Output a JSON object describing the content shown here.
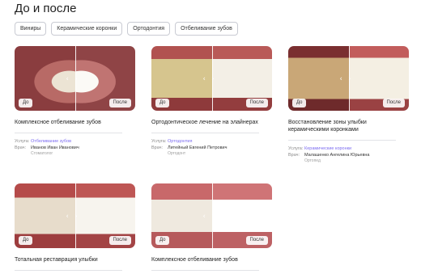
{
  "page": {
    "title": "До и после"
  },
  "filters": [
    "Виниры",
    "Керамические коронки",
    "Ортодонтия",
    "Отбеливание зубов"
  ],
  "labels": {
    "before": "До",
    "after": "После",
    "service": "Услуга:",
    "doctor": "Врач:"
  },
  "cards": [
    {
      "title": "Комплексное отбеливание зубов",
      "service": "Отбеливание зубов",
      "doctor": "Иванов Иван Иванович",
      "role": "Стоматолог",
      "before_palette": "p-lips-b",
      "after_palette": "p-lips-a"
    },
    {
      "title": "Ортодонтическое лечение на элайнерах",
      "service": "Ортодонтия",
      "doctor": "Литейный Евгений Петрович",
      "role": "Ортодонт",
      "before_palette": "p-yellow-b",
      "after_palette": "p-yellow-a"
    },
    {
      "title": "Восстановление зоны улыбки керамическими коронками",
      "service": "Керамические коронки",
      "doctor": "Малашенко Ангелина Юрьевна",
      "role": "Ортопед",
      "before_palette": "p-brown-b",
      "after_palette": "p-brown-a"
    },
    {
      "title": "Тотальная реставрация улыбки",
      "before_palette": "p-teeth-b",
      "after_palette": "p-teeth-a"
    },
    {
      "title": "Комплексное отбеливание зубов",
      "before_palette": "p-white-b",
      "after_palette": "p-white-a"
    }
  ],
  "icons": {
    "arrow_left": "‹",
    "arrow_right": "›"
  }
}
